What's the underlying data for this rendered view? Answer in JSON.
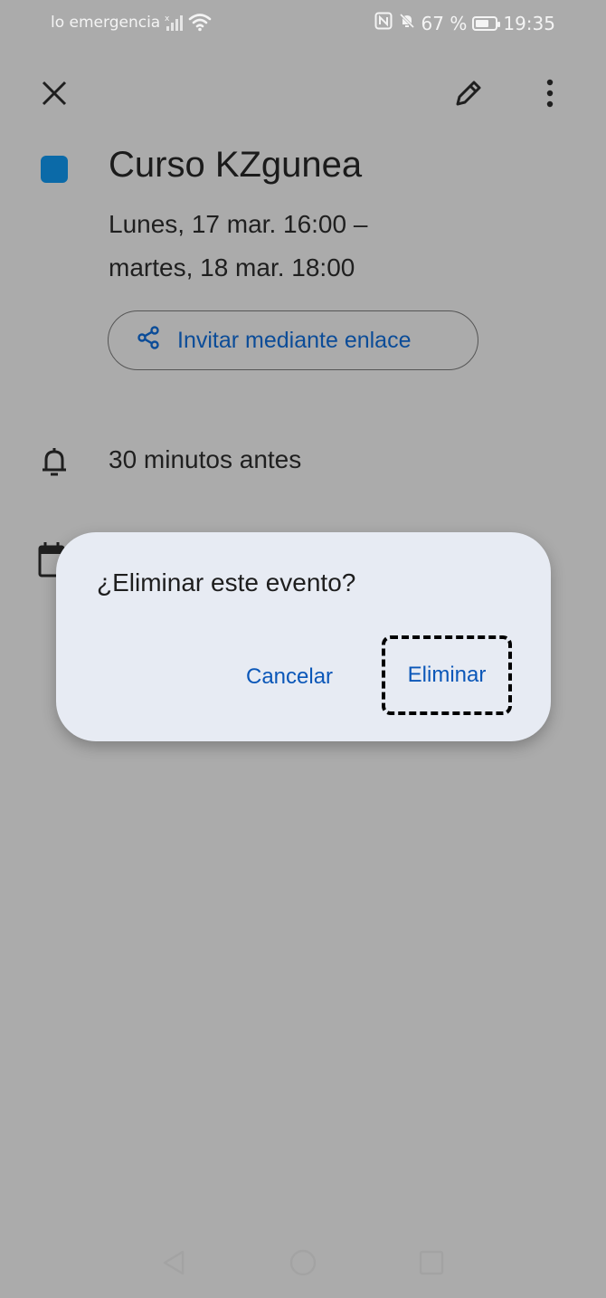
{
  "status_bar": {
    "left_text": "lo emergencia",
    "battery_percent": "67 %",
    "time": "19:35"
  },
  "event": {
    "title": "Curso KZgunea",
    "date_line1": "Lunes, 17 mar. 16:00 –",
    "date_line2": "martes, 18 mar. 18:00",
    "invite_label": "Invitar mediante enlace",
    "reminder": "30 minutos antes",
    "color": "#0b6aa8"
  },
  "dialog": {
    "title": "¿Eliminar este evento?",
    "cancel_label": "Cancelar",
    "delete_label": "Eliminar"
  }
}
